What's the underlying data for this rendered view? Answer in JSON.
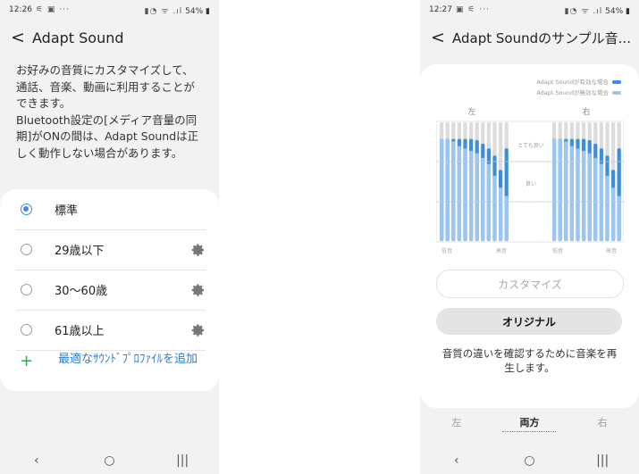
{
  "left": {
    "status": {
      "time": "12:26",
      "icons": "⚟ ▣ ···",
      "signal": "▮◔ ᯤ .ıl",
      "battery": "54%"
    },
    "title": "Adapt Sound",
    "description": "お好みの音質にカスタマイズして、通話、音楽、動画に利用することができます。\nBluetooth設定の[メディア音量の同期]がONの間は、Adapt Soundは正しく動作しない場合があります。",
    "options": [
      {
        "label": "標準",
        "checked": true,
        "settings": false
      },
      {
        "label": "29歳以下",
        "checked": false,
        "settings": true
      },
      {
        "label": "30〜60歳",
        "checked": false,
        "settings": true
      },
      {
        "label": "61歳以上",
        "checked": false,
        "settings": true
      }
    ],
    "add_label": "最適なｻｳﾝﾄﾞﾌﾟﾛﾌｧｲﾙを追加",
    "add_icon": "+",
    "nav": {
      "back": "‹",
      "home": "○",
      "recent": "|||"
    }
  },
  "right": {
    "status": {
      "time": "12:27",
      "icons": "▣ ⚟ ···",
      "signal": "▮◔ ᯤ .ıl",
      "battery": "54%"
    },
    "title": "Adapt Soundのサンプル音...",
    "legend": [
      {
        "label": "Adapt Soundが有効な場合",
        "color": "#3b8fde"
      },
      {
        "label": "Adapt Soundが無効な場合",
        "color": "#9cc6ee"
      }
    ],
    "chart": {
      "left_label": "左",
      "right_label": "右",
      "level_labels": [
        "とても良い",
        "良い"
      ],
      "left_low": "低音",
      "left_high": "高音",
      "right_low": "低音",
      "right_high": "高音"
    },
    "chart_data": {
      "type": "bar",
      "series": [
        {
          "name": "Adapt Soundが有効な場合",
          "left": [
            0.86,
            0.86,
            0.86,
            0.86,
            0.86,
            0.86,
            0.85,
            0.82,
            0.78,
            0.72,
            0.6,
            0.78
          ],
          "right": [
            0.86,
            0.86,
            0.86,
            0.86,
            0.86,
            0.86,
            0.85,
            0.82,
            0.78,
            0.72,
            0.6,
            0.78
          ]
        },
        {
          "name": "Adapt Soundが無効な場合",
          "left": [
            0.86,
            0.86,
            0.84,
            0.8,
            0.78,
            0.76,
            0.74,
            0.7,
            0.65,
            0.55,
            0.45,
            0.38
          ],
          "right": [
            0.86,
            0.86,
            0.84,
            0.8,
            0.78,
            0.76,
            0.74,
            0.7,
            0.65,
            0.55,
            0.45,
            0.38
          ]
        }
      ],
      "colors": {
        "enabled": "#3b8fde",
        "disabled": "#9cc6ee",
        "background": "#dcdcdc"
      }
    },
    "buttons": {
      "customize": "カスタマイズ",
      "original": "オリジナル"
    },
    "description": "音質の違いを確認するために音楽を再生します。",
    "tabs": [
      {
        "label": "左",
        "active": false
      },
      {
        "label": "両方",
        "active": true
      },
      {
        "label": "右",
        "active": false
      }
    ],
    "nav": {
      "back": "‹",
      "home": "○",
      "recent": "|||"
    }
  }
}
